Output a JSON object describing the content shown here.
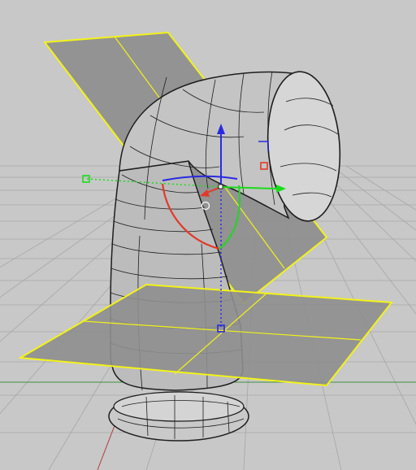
{
  "viewport": {
    "view": "perspective",
    "background_color": "#c8c8c8",
    "grid_color": "#a6a6a6",
    "axis_x_color": "#b04040",
    "axis_y_color": "#3f8f3f"
  },
  "model": {
    "object": "elbow-pipe",
    "surface_color": "#bcbcbc",
    "isocurve_color": "#1e1e1e",
    "selection_color": "#f2f21a",
    "plane_fill_color": "#8e8e8e"
  },
  "gizmo": {
    "x_axis_color": "#1bdc1b",
    "y_axis_color": "#e23a2a",
    "z_axis_color": "#2a2ae2",
    "rotation_arc_colors": [
      "#e23a2a",
      "#2bd02b"
    ],
    "center_icon": "circle-icon",
    "x_handle_icon": "square-handle-icon",
    "z_handle_icon": "square-handle-icon",
    "scale_handle_icon": "red-square-icon"
  }
}
